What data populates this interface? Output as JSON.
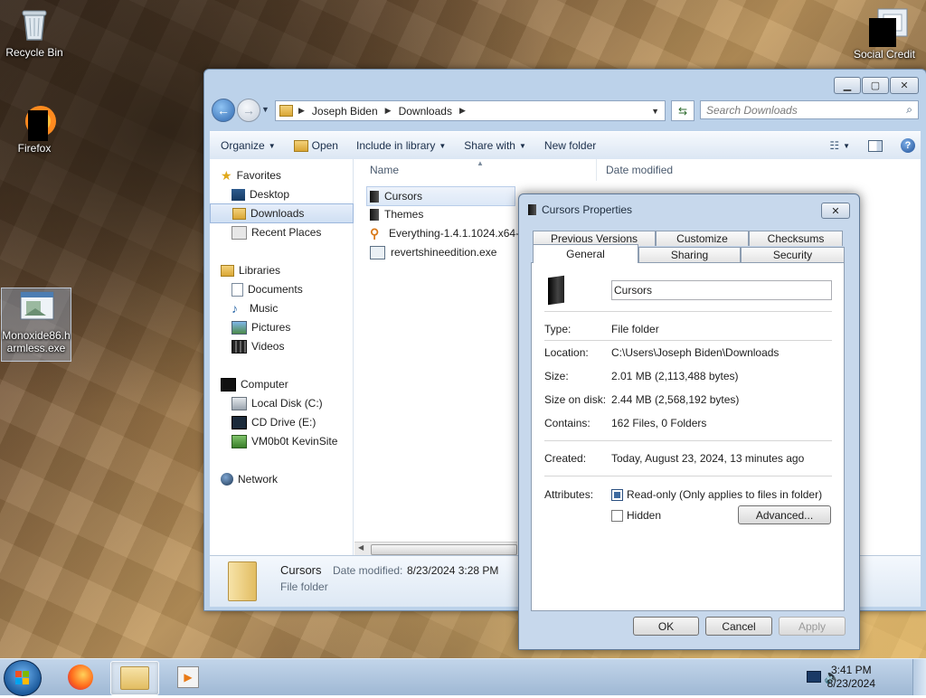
{
  "desktop": {
    "icons": {
      "recycle_bin": "Recycle Bin",
      "firefox": "Firefox",
      "monoxide": "Monoxide86.harmless.exe",
      "social_credit": "Social Credit"
    }
  },
  "explorer": {
    "breadcrumb": [
      "Joseph Biden",
      "Downloads"
    ],
    "search_placeholder": "Search Downloads",
    "toolbar": {
      "organize": "Organize",
      "open": "Open",
      "include_in_library": "Include in library",
      "share_with": "Share with",
      "new_folder": "New folder"
    },
    "nav": {
      "favorites": "Favorites",
      "desktop": "Desktop",
      "downloads": "Downloads",
      "recent_places": "Recent Places",
      "libraries": "Libraries",
      "documents": "Documents",
      "music": "Music",
      "pictures": "Pictures",
      "videos": "Videos",
      "computer": "Computer",
      "local_disk": "Local Disk (C:)",
      "cd_drive": "CD Drive (E:)",
      "vm_share": "VM0b0t KevinSite",
      "network": "Network"
    },
    "columns": {
      "name": "Name",
      "date_modified": "Date modified"
    },
    "files": [
      {
        "name": "Cursors",
        "date": "8/23/2024 3:28 PM"
      },
      {
        "name": "Themes",
        "date": ""
      },
      {
        "name": "Everything-1.4.1.1024.x64-S",
        "date": ""
      },
      {
        "name": "revertshineedition.exe",
        "date": ""
      }
    ],
    "details_pane": {
      "name": "Cursors",
      "date_label": "Date modified:",
      "date_value": "8/23/2024 3:28 PM",
      "type": "File folder"
    }
  },
  "properties": {
    "title": "Cursors Properties",
    "tabs_top": [
      "Previous Versions",
      "Customize",
      "Checksums"
    ],
    "tabs_bottom": [
      "General",
      "Sharing",
      "Security"
    ],
    "folder_name": "Cursors",
    "rows": {
      "type_label": "Type:",
      "type_value": "File folder",
      "location_label": "Location:",
      "location_value": "C:\\Users\\Joseph Biden\\Downloads",
      "size_label": "Size:",
      "size_value": "2.01 MB (2,113,488 bytes)",
      "size_on_disk_label": "Size on disk:",
      "size_on_disk_value": "2.44 MB (2,568,192 bytes)",
      "contains_label": "Contains:",
      "contains_value": "162 Files, 0 Folders",
      "created_label": "Created:",
      "created_value": "Today, August 23, 2024, 13 minutes ago",
      "attributes_label": "Attributes:"
    },
    "readonly_label": "Read-only (Only applies to files in folder)",
    "hidden_label": "Hidden",
    "advanced_label": "Advanced...",
    "ok_label": "OK",
    "cancel_label": "Cancel",
    "apply_label": "Apply"
  },
  "taskbar": {
    "time": "3:41 PM",
    "date": "8/23/2024"
  }
}
